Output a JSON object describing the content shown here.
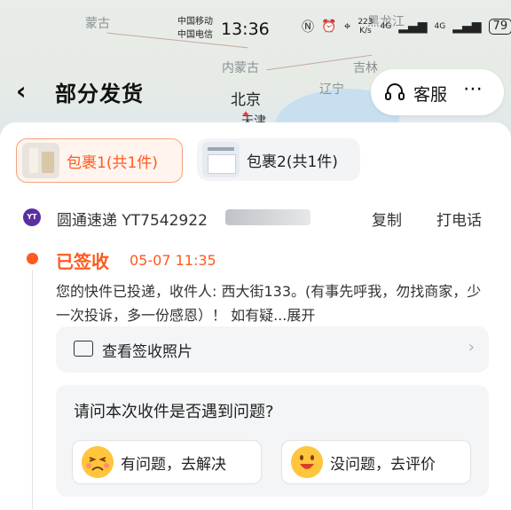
{
  "status_bar": {
    "carrier1": "中国移动",
    "carrier2": "中国电信",
    "time": "13:36",
    "speed": "223 K/s",
    "network1": "4G",
    "network2": "4G",
    "battery": "79"
  },
  "map": {
    "labels": [
      "蒙古",
      "黑龙江",
      "内蒙古",
      "吉林",
      "辽宁",
      "北京",
      "天津"
    ]
  },
  "header": {
    "title": "部分发货",
    "service_label": "客服",
    "more_icon": "⋯"
  },
  "packages": [
    {
      "label": "包裹1(共1件)",
      "active": true
    },
    {
      "label": "包裹2(共1件)",
      "active": false
    }
  ],
  "courier": {
    "logo_text": "YT",
    "name_and_tracking": "圆通速递 YT7542922",
    "copy_label": "复制",
    "call_label": "打电话"
  },
  "tracking": {
    "status": "已签收",
    "time": "05-07 11:35",
    "description": "您的快件已投递，收件人: 西大街133。(有事先呼我，勿找商家，少一次投诉，多一份感恩）！ 如有疑...展开"
  },
  "photo": {
    "label": "查看签收照片"
  },
  "question": {
    "title": "请问本次收件是否遇到问题?",
    "option1": "有问题，去解决",
    "option2": "没问题，去评价"
  },
  "colors": {
    "accent": "#ff5a1f",
    "courier_logo": "#5a2fa0"
  }
}
